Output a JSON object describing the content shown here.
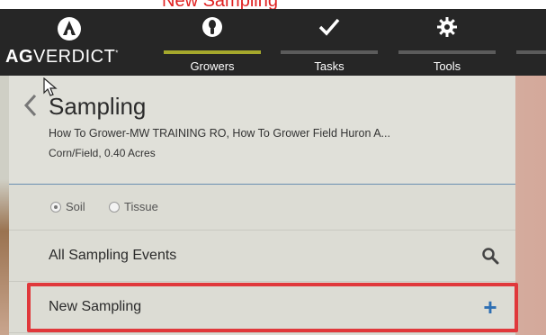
{
  "header_caption": "New Sampling",
  "brand": {
    "bold": "AG",
    "light": "VERDICT",
    "mark": "ag-logo-icon"
  },
  "nav": {
    "tabs": [
      {
        "label": "Growers",
        "icon": "grower-icon",
        "active": true
      },
      {
        "label": "Tasks",
        "icon": "check-icon",
        "active": false
      },
      {
        "label": "Tools",
        "icon": "gear-icon",
        "active": false
      }
    ]
  },
  "panel": {
    "title": "Sampling",
    "subtitle": "How To Grower-MW TRAINING RO, How To Grower Field Huron A...",
    "detail": "Corn/Field, 0.40 Acres",
    "sample_type": {
      "options": [
        "Soil",
        "Tissue"
      ],
      "selected": "Soil"
    },
    "rows": [
      {
        "label": "All Sampling Events",
        "icon": "search-icon"
      },
      {
        "label": "New Sampling",
        "icon": "plus-icon"
      }
    ]
  },
  "colors": {
    "nav_bg": "#262626",
    "active_tab": "#a5a82c",
    "highlight": "#e0383b",
    "plus": "#2e6fb3"
  }
}
